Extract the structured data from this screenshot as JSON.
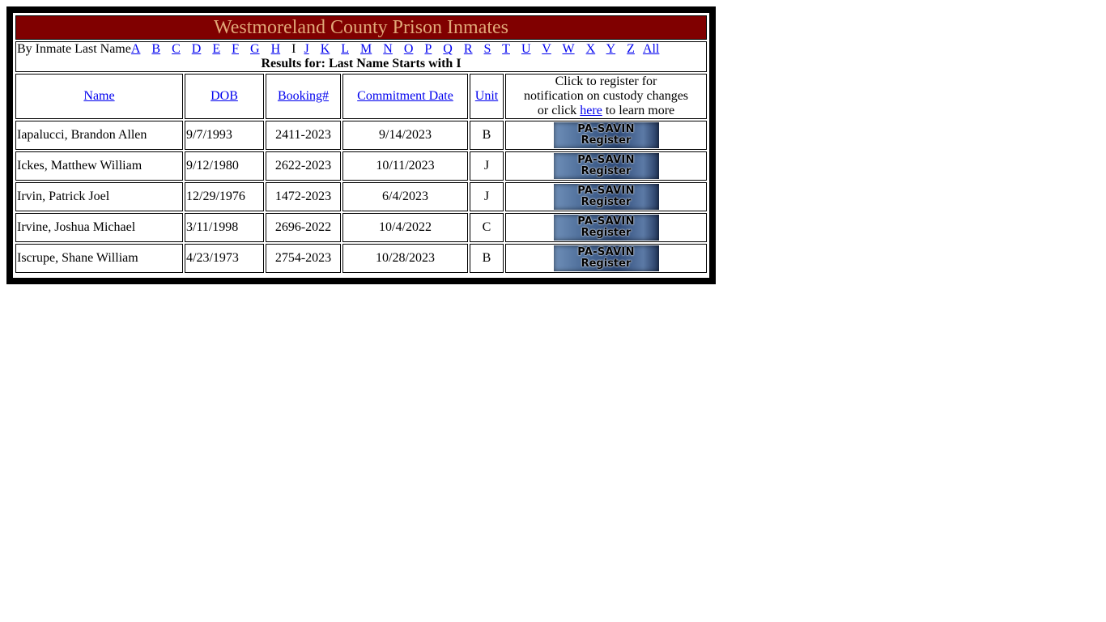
{
  "title": "Westmoreland County Prison Inmates",
  "nav": {
    "prefix": "By Inmate Last Name",
    "letters": [
      "A",
      "B",
      "C",
      "D",
      "E",
      "F",
      "G",
      "H",
      "I",
      "J",
      "K",
      "L",
      "M",
      "N",
      "O",
      "P",
      "Q",
      "R",
      "S",
      "T",
      "U",
      "V",
      "W",
      "X",
      "Y",
      "Z"
    ],
    "current": "I",
    "all_label": "All",
    "results_text": "Results for: Last Name Starts with I"
  },
  "columns": {
    "name": "Name",
    "dob": "DOB",
    "booking": "Booking#",
    "commitment": "Commitment Date",
    "unit": "Unit",
    "register_line1": "Click to register for",
    "register_line2": "notification on custody changes",
    "register_pre": "or click ",
    "register_link": "here",
    "register_post": " to learn more"
  },
  "button": {
    "line1": "PA-SAVIN",
    "line2": "Register"
  },
  "rows": [
    {
      "name": "Iapalucci, Brandon Allen",
      "dob": "9/7/1993",
      "booking": "2411-2023",
      "commitment": "9/14/2023",
      "unit": "B"
    },
    {
      "name": "Ickes, Matthew William",
      "dob": "9/12/1980",
      "booking": "2622-2023",
      "commitment": "10/11/2023",
      "unit": "J"
    },
    {
      "name": "Irvin, Patrick Joel",
      "dob": "12/29/1976",
      "booking": "1472-2023",
      "commitment": "6/4/2023",
      "unit": "J"
    },
    {
      "name": "Irvine, Joshua Michael",
      "dob": "3/11/1998",
      "booking": "2696-2022",
      "commitment": "10/4/2022",
      "unit": "C"
    },
    {
      "name": "Iscrupe, Shane William",
      "dob": "4/23/1973",
      "booking": "2754-2023",
      "commitment": "10/28/2023",
      "unit": "B"
    }
  ],
  "colors": {
    "title_bg": "#800000",
    "title_text": "#e0a878",
    "link": "#0000ee",
    "frame": "#000000"
  }
}
